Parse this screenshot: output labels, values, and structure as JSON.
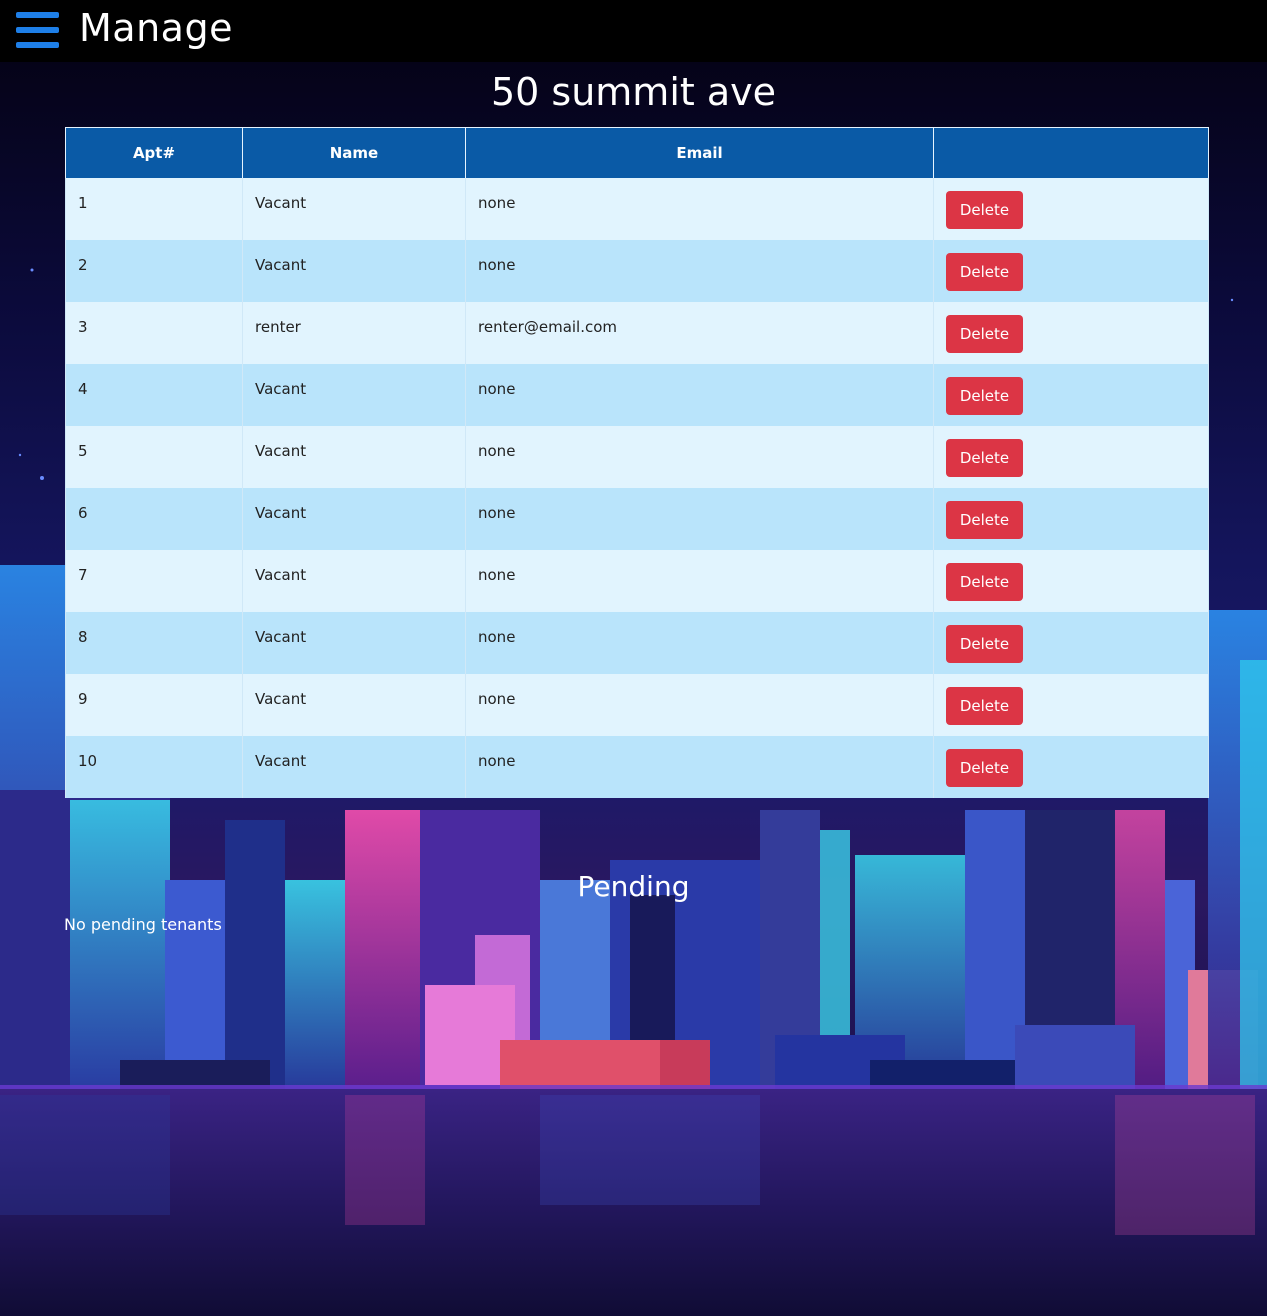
{
  "header": {
    "title": "Manage",
    "menu_icon": "hamburger-menu-icon",
    "accent": "#1e7fe8"
  },
  "building": {
    "name": "50 summit ave"
  },
  "table": {
    "columns": [
      "Apt#",
      "Name",
      "Email",
      ""
    ],
    "header_color": "#0a5aa6",
    "rows": [
      {
        "apt": "1",
        "name": "Vacant",
        "email": "none",
        "action": "Delete"
      },
      {
        "apt": "2",
        "name": "Vacant",
        "email": "none",
        "action": "Delete"
      },
      {
        "apt": "3",
        "name": "renter",
        "email": "renter@email.com",
        "action": "Delete"
      },
      {
        "apt": "4",
        "name": "Vacant",
        "email": "none",
        "action": "Delete"
      },
      {
        "apt": "5",
        "name": "Vacant",
        "email": "none",
        "action": "Delete"
      },
      {
        "apt": "6",
        "name": "Vacant",
        "email": "none",
        "action": "Delete"
      },
      {
        "apt": "7",
        "name": "Vacant",
        "email": "none",
        "action": "Delete"
      },
      {
        "apt": "8",
        "name": "Vacant",
        "email": "none",
        "action": "Delete"
      },
      {
        "apt": "9",
        "name": "Vacant",
        "email": "none",
        "action": "Delete"
      },
      {
        "apt": "10",
        "name": "Vacant",
        "email": "none",
        "action": "Delete"
      }
    ],
    "delete_color": "#dc3545"
  },
  "pending": {
    "title": "Pending",
    "empty_message": "No pending tenants"
  }
}
